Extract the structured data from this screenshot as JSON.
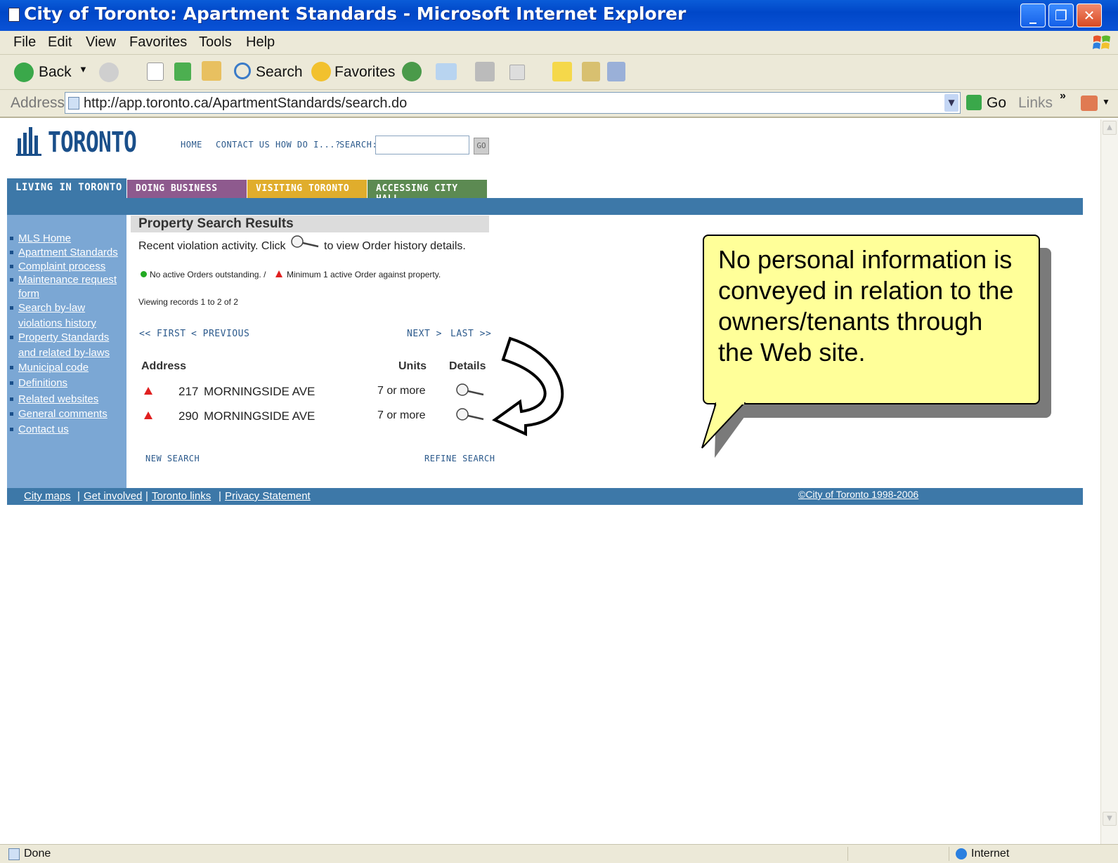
{
  "window": {
    "title": "City of Toronto: Apartment Standards - Microsoft Internet Explorer",
    "minimize": "_",
    "restore": "❐",
    "close": "✕"
  },
  "menu": [
    "File",
    "Edit",
    "View",
    "Favorites",
    "Tools",
    "Help"
  ],
  "toolbar": {
    "back": "Back",
    "search": "Search",
    "favorites": "Favorites"
  },
  "address": {
    "label": "Address",
    "url": "http://app.toronto.ca/ApartmentStandards/search.do",
    "go": "Go",
    "links": "Links"
  },
  "site": {
    "logo": "TORONTO",
    "topnav": [
      "HOME",
      "CONTACT US",
      "HOW DO I...?",
      "SEARCH:"
    ],
    "go_button": "GO",
    "tabs": [
      {
        "label": "LIVING IN TORONTO",
        "color": "#3d78a8"
      },
      {
        "label": "DOING BUSINESS",
        "color": "#8e5a8e"
      },
      {
        "label": "VISITING TORONTO",
        "color": "#e0ad2c"
      },
      {
        "label": "ACCESSING CITY HALL",
        "color": "#5c8a52"
      }
    ],
    "leftnav": [
      "MLS Home",
      "Apartment Standards",
      "Complaint process",
      "Maintenance request",
      "form",
      "Search by-law",
      "violations history",
      "Property Standards",
      "and related by-laws",
      "Municipal code",
      "Definitions",
      "Related websites",
      "General comments",
      "Contact us"
    ]
  },
  "results": {
    "heading": "Property Search Results",
    "intro_before": "Recent violation activity. Click",
    "intro_after": "to view Order history details.",
    "legend_green": "No active Orders outstanding. /",
    "legend_red": "Minimum 1 active Order against property.",
    "viewing": "Viewing records 1 to 2 of 2",
    "pager": {
      "first": "<< FIRST",
      "previous": "< PREVIOUS",
      "next": "NEXT >",
      "last": "LAST >>"
    },
    "columns": {
      "address": "Address",
      "units": "Units",
      "details": "Details"
    },
    "rows": [
      {
        "number": "217",
        "street": "MORNINGSIDE  AVE",
        "units": "7 or more"
      },
      {
        "number": "290",
        "street": "MORNINGSIDE  AVE",
        "units": "7 or more"
      }
    ],
    "new_search": "NEW SEARCH",
    "refine_search": "REFINE SEARCH"
  },
  "footer": {
    "links": [
      "City maps",
      "Get involved",
      "Toronto links",
      "Privacy Statement"
    ],
    "separator": "|",
    "copyright": "©City of Toronto 1998-2006"
  },
  "callout": {
    "text": "No personal information is conveyed in relation to the owners/tenants through the Web site."
  },
  "status": {
    "left": "Done",
    "zone": "Internet"
  },
  "colors": {
    "title_bar": "#0a52d6",
    "chrome": "#ece9d8",
    "site_blue": "#3d78a8",
    "leftnav_blue": "#7ba7d4",
    "callout_fill": "#ffff99",
    "violation_red": "#e02020",
    "ok_green": "#22aa22"
  }
}
